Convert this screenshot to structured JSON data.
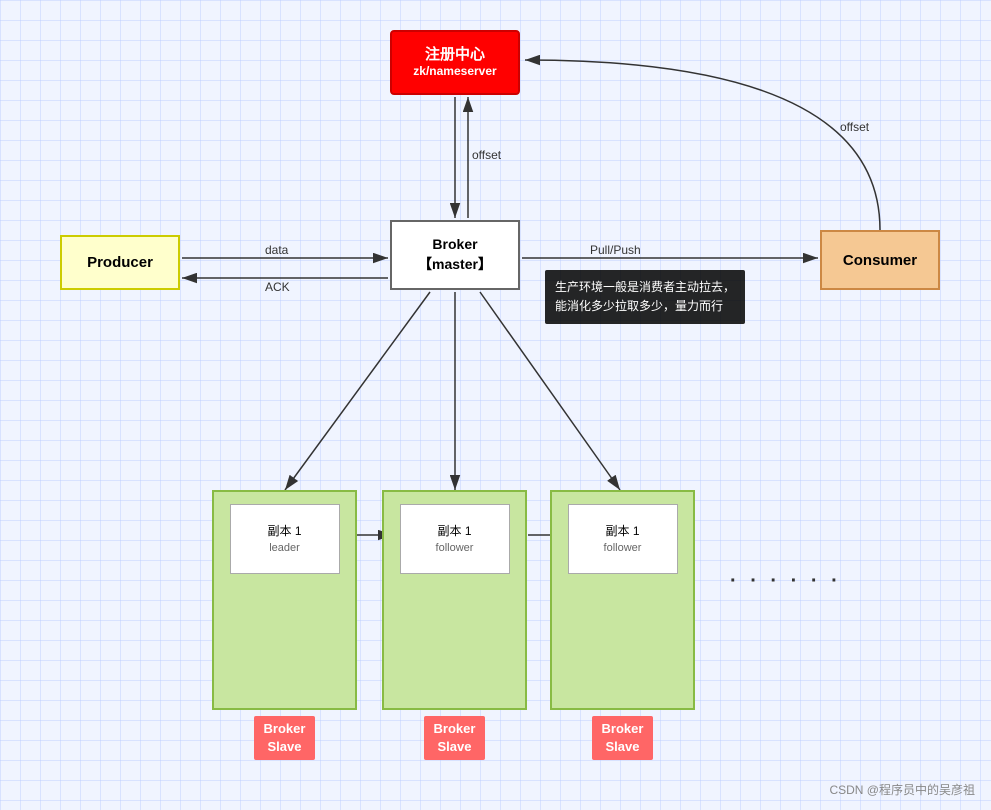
{
  "registry": {
    "line1": "注册中心",
    "line2": "zk/nameserver"
  },
  "broker_master": {
    "line1": "Broker",
    "line2": "【master】"
  },
  "producer": {
    "label": "Producer"
  },
  "consumer": {
    "label": "Consumer"
  },
  "tooltip": {
    "text": "生产环境一般是消费者主动拉去，能消化多少拉取多少，量力而行"
  },
  "arrows": {
    "data_label": "data",
    "ack_label": "ACK",
    "offset_label1": "offset",
    "offset_label2": "offset",
    "pull_push_label": "Pull/Push"
  },
  "slaves": [
    {
      "replica_label": "副本 1",
      "role": "leader",
      "broker_label1": "Broker",
      "broker_label2": "Slave"
    },
    {
      "replica_label": "副本 1",
      "role": "follower",
      "broker_label1": "Broker",
      "broker_label2": "Slave"
    },
    {
      "replica_label": "副本 1",
      "role": "follower",
      "broker_label1": "Broker",
      "broker_label2": "Slave"
    }
  ],
  "dots": "· · · · · ·",
  "footer": "CSDN @程序员中的吴彦祖"
}
